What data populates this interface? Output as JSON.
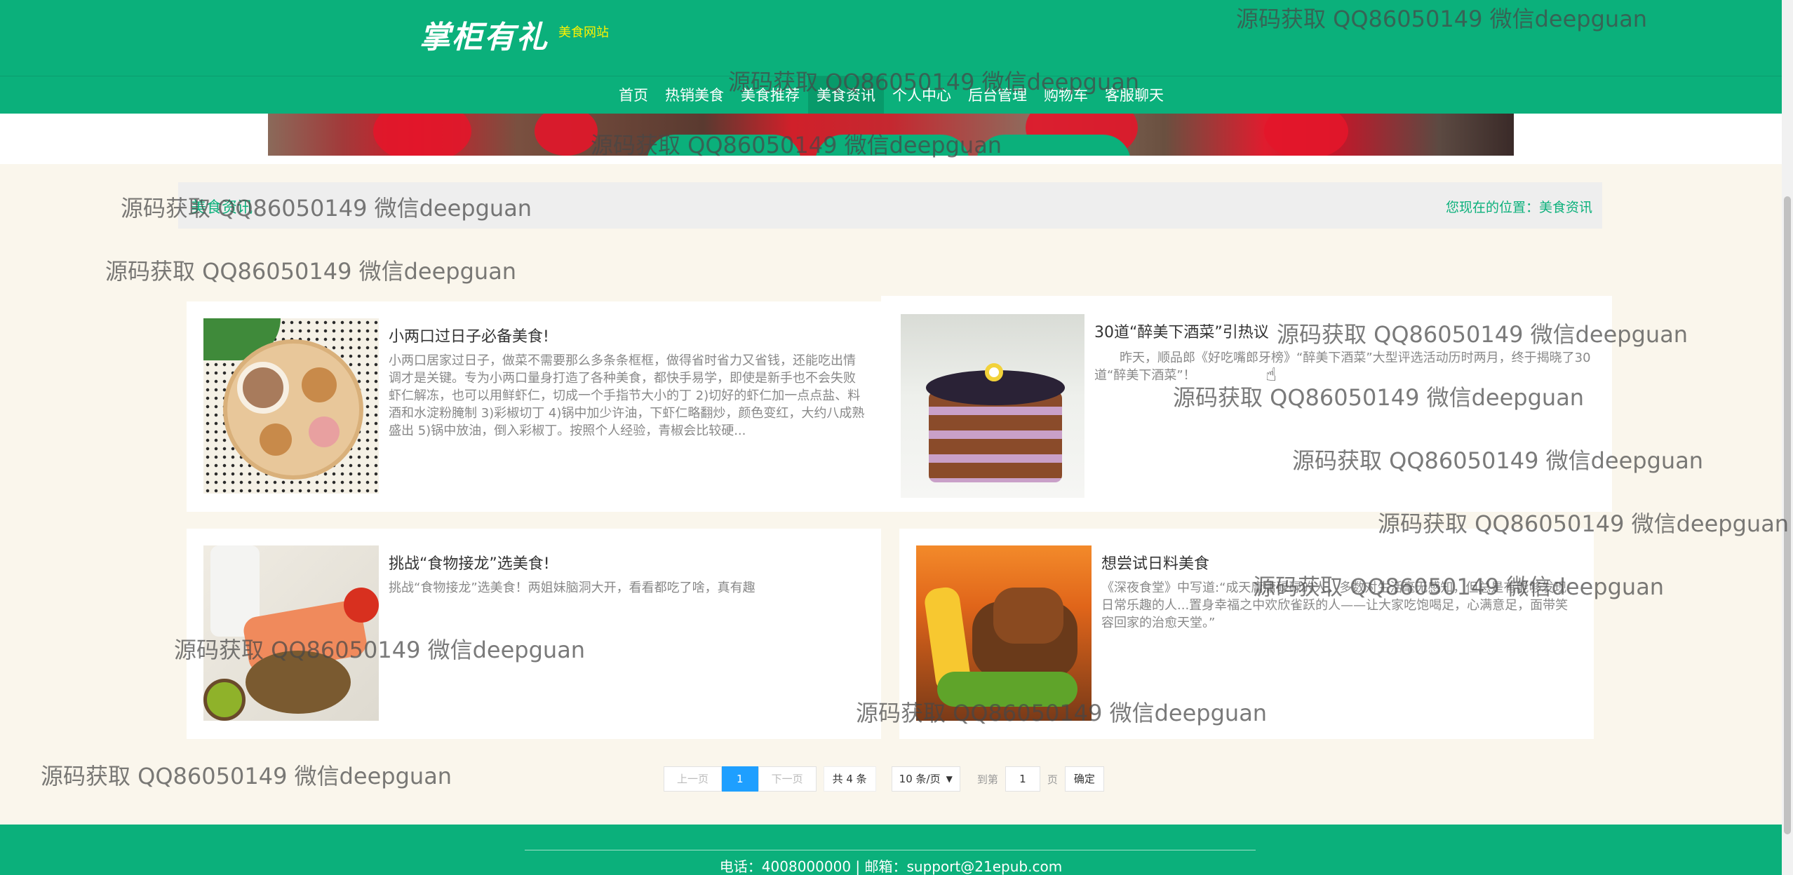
{
  "header": {
    "logo_text": "掌柜有礼",
    "site_tag": "美食网站"
  },
  "nav": {
    "items": [
      {
        "label": "首页"
      },
      {
        "label": "热销美食"
      },
      {
        "label": "美食推荐"
      },
      {
        "label": "美食资讯",
        "active": true
      },
      {
        "label": "个人中心"
      },
      {
        "label": "后台管理"
      },
      {
        "label": "购物车"
      },
      {
        "label": "客服聊天"
      }
    ]
  },
  "breadcrumb": {
    "left": "美食资讯",
    "prefix": "您现在的位置：",
    "current": "美食资讯"
  },
  "articles": [
    {
      "title": "小两口过日子必备美食!",
      "desc": "小两口居家过日子，做菜不需要那么多条条框框，做得省时省力又省钱，还能吃出情调才是关键。专为小两口量身打造了各种美食，都快手易学，即使是新手也不会失败虾仁解冻，也可以用鲜虾仁，切成一个手指节大小的丁 2)切好的虾仁加一点点盐、料酒和水淀粉腌制 3)彩椒切丁 4)锅中加少许油，下虾仁略翻炒，颜色变红，大约八成熟盛出 5)锅中放油，倒入彩椒丁。按照个人经验，青椒会比较硬...",
      "image": "dessert-plate-image"
    },
    {
      "title": "30道“醉美下酒菜”引热议",
      "desc": "昨天，顺品郎《好吃嘴郎牙榜》“醉美下酒菜”大型评选活动历时两月，终于揭晓了30道“醉美下酒菜”！",
      "image": "blackberry-cake-image"
    },
    {
      "title": "挑战“食物接龙”选美食!",
      "desc": "挑战“食物接龙”选美食！两姐妹脑洞大开，看看都吃了啥，真有趣",
      "image": "healthy-food-image"
    },
    {
      "title": "想尝试日料美食",
      "desc": "《深夜食堂》中写道:“成天庸庸碌碌的人，多数对生活毫无感知，但总是有能够发现日常乐趣的人...置身幸福之中欢欣雀跃的人——让大家吃饱喝足，心满意足，面带笑容回家的治愈天堂。”",
      "image": "grilled-skewers-image"
    }
  ],
  "pagination": {
    "prev": "上一页",
    "current_page": "1",
    "next": "下一页",
    "total": "共 4 条",
    "page_size": "10 条/页",
    "goto_prefix": "到第",
    "goto_value": "1",
    "goto_suffix": "页",
    "confirm": "确定"
  },
  "footer": {
    "contact": "电话：4008000000 | 邮箱：support@21epub.com"
  },
  "watermark": {
    "text": "源码获取 QQ86050149 微信deepguan"
  },
  "colors": {
    "brand_green": "#0bb07b",
    "accent_yellow": "#fff200",
    "pager_blue": "#1e9fff",
    "page_bg": "#faf6ec"
  }
}
